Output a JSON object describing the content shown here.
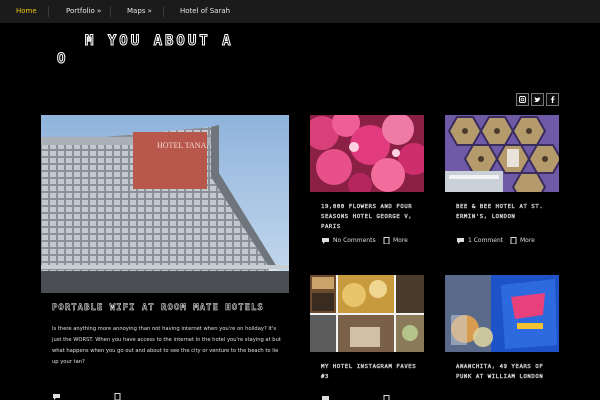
{
  "nav": {
    "items": [
      {
        "label": "Home",
        "active": true
      },
      {
        "label": "Portfolio »",
        "active": false
      },
      {
        "label": "Maps »",
        "active": false
      },
      {
        "label": "Hotel of Sarah",
        "active": false
      }
    ]
  },
  "hero": {
    "headline": "M      YOU ABOUT A",
    "mark": "O"
  },
  "social": {
    "icons": [
      "instagram-icon",
      "twitter-icon",
      "facebook-icon"
    ]
  },
  "featured": {
    "image_text": "HOTEL TANA",
    "title": "PORTABLE WIFI AT ROOM MATE HOTELS",
    "excerpt": "Is there anything more annoying than not having internet when you're on holiday? It's just the WORST. When you have access to the internet in the hotel you're staying at but what happens when you go out and about to see the city or venture to the beach to lie up your tan?"
  },
  "cards": [
    {
      "title": "19,000 FLOWERS AND FOUR SEASONS HOTEL GEORGE V, PARIS",
      "comments": "No Comments",
      "more": "More"
    },
    {
      "title": "BEE & BEE HOTEL AT ST. ERMIN'S, LONDON",
      "comments": "1 Comment",
      "more": "More"
    },
    {
      "title": "MY HOTEL INSTAGRAM FAVES #3",
      "comments": "",
      "more": ""
    },
    {
      "title": "ANANCHITA, 49 YEARS OF PUNK AT WILLIAM LONDON",
      "comments": "",
      "more": ""
    }
  ],
  "colors": {
    "background": "#000000",
    "nav_background": "#1b1b1b",
    "nav_active": "#f1c40f"
  }
}
